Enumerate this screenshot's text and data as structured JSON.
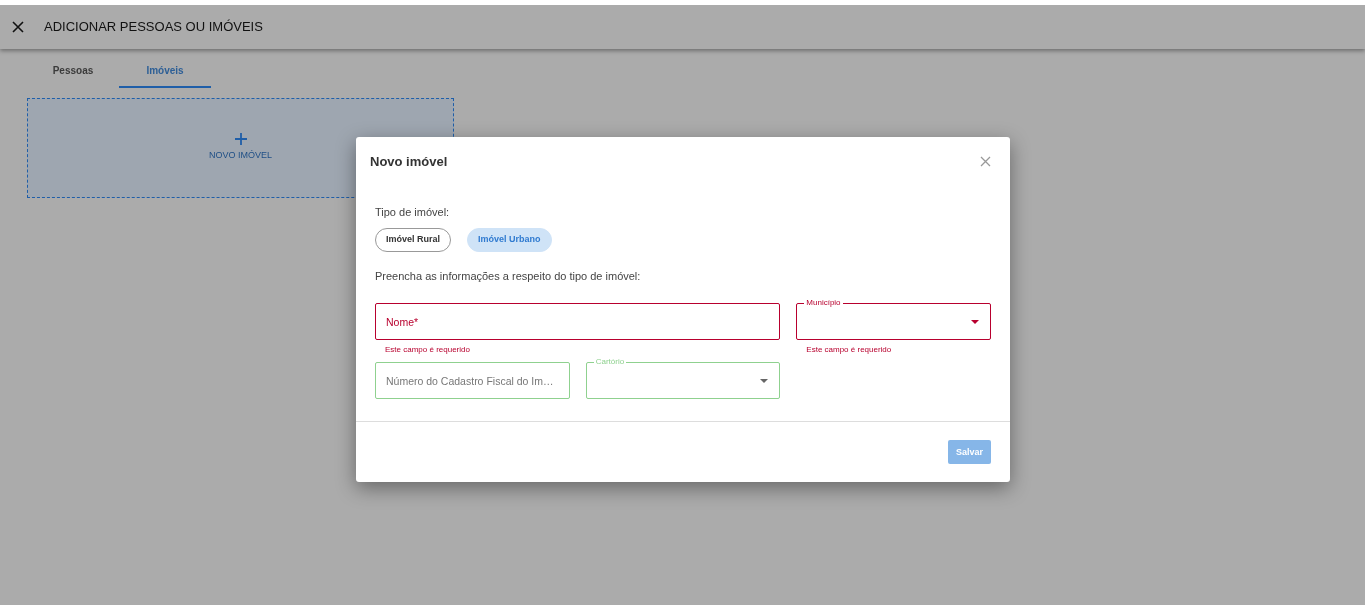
{
  "header": {
    "title": "ADICIONAR PESSOAS OU IMÓVEIS"
  },
  "tabs": [
    {
      "label": "Pessoas",
      "selected": false
    },
    {
      "label": "Imóveis",
      "selected": true
    }
  ],
  "add_card": {
    "label": "NOVO IMÓVEL"
  },
  "dialog": {
    "title": "Novo imóvel",
    "type_label": "Tipo de imóvel:",
    "types": [
      {
        "label": "Imóvel Rural",
        "selected": false
      },
      {
        "label": "Imóvel Urbano",
        "selected": true
      }
    ],
    "instructions": "Preencha as informações a respeito do tipo de imóvel:",
    "fields": [
      {
        "kind": "text",
        "placeholder": "Nome*",
        "invalid": true,
        "error": "Este campo é requerido"
      },
      {
        "kind": "select",
        "label": "Município",
        "invalid": true,
        "error": "Este campo é requerido"
      },
      {
        "kind": "text",
        "placeholder": "Número do Cadastro Fiscal do Im…",
        "invalid": false
      },
      {
        "kind": "select",
        "label": "Cartório",
        "invalid": false
      }
    ],
    "save_button": {
      "label": "Salvar",
      "disabled": true
    }
  }
}
